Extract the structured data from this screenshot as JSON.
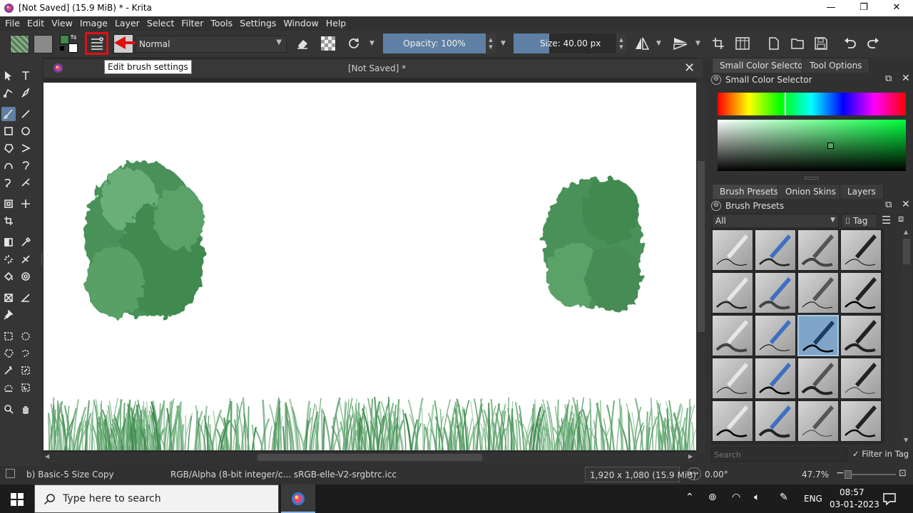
{
  "window": {
    "title": "[Not Saved]  (15.9 MiB)  * - Krita",
    "minimize": "—",
    "maximize": "❐",
    "close": "✕"
  },
  "menu": [
    "File",
    "Edit",
    "View",
    "Image",
    "Layer",
    "Select",
    "Filter",
    "Tools",
    "Settings",
    "Window",
    "Help"
  ],
  "toolbar": {
    "blend_mode": "Normal",
    "opacity": "Opacity: 100%",
    "size": "Size: 40.00 px",
    "tooltip": "Edit brush settings"
  },
  "document": {
    "tab_title": "[Not Saved]  *"
  },
  "docker_top": {
    "tabs": [
      "Small Color Selector",
      "Tool Options"
    ],
    "header": "Small Color Selector"
  },
  "docker_bottom": {
    "tabs": [
      "Brush Presets",
      "Onion Skins",
      "Layers"
    ],
    "header": "Brush Presets",
    "filter_value": "All",
    "tag_label": "Tag",
    "search_placeholder": "Search",
    "filter_in_tag": "Filter in Tag"
  },
  "status": {
    "brush_name": "b) Basic-5 Size Copy",
    "color_profile": "RGB/Alpha (8-bit integer/c...  sRGB-elle-V2-srgbtrc.icc",
    "dimensions": "1,920 x 1,080 (15.9 MiB)",
    "rotation": "0.00°",
    "zoom": "47.7%"
  },
  "taskbar": {
    "search_placeholder": "Type here to search",
    "language": "ENG",
    "time": "08:57",
    "date": "03-01-2023"
  },
  "colors": {
    "accent": "#5f80a4",
    "highlight_box": "#e01010",
    "foliage_dark": "#3f8a4f",
    "foliage_light": "#6aae78"
  }
}
